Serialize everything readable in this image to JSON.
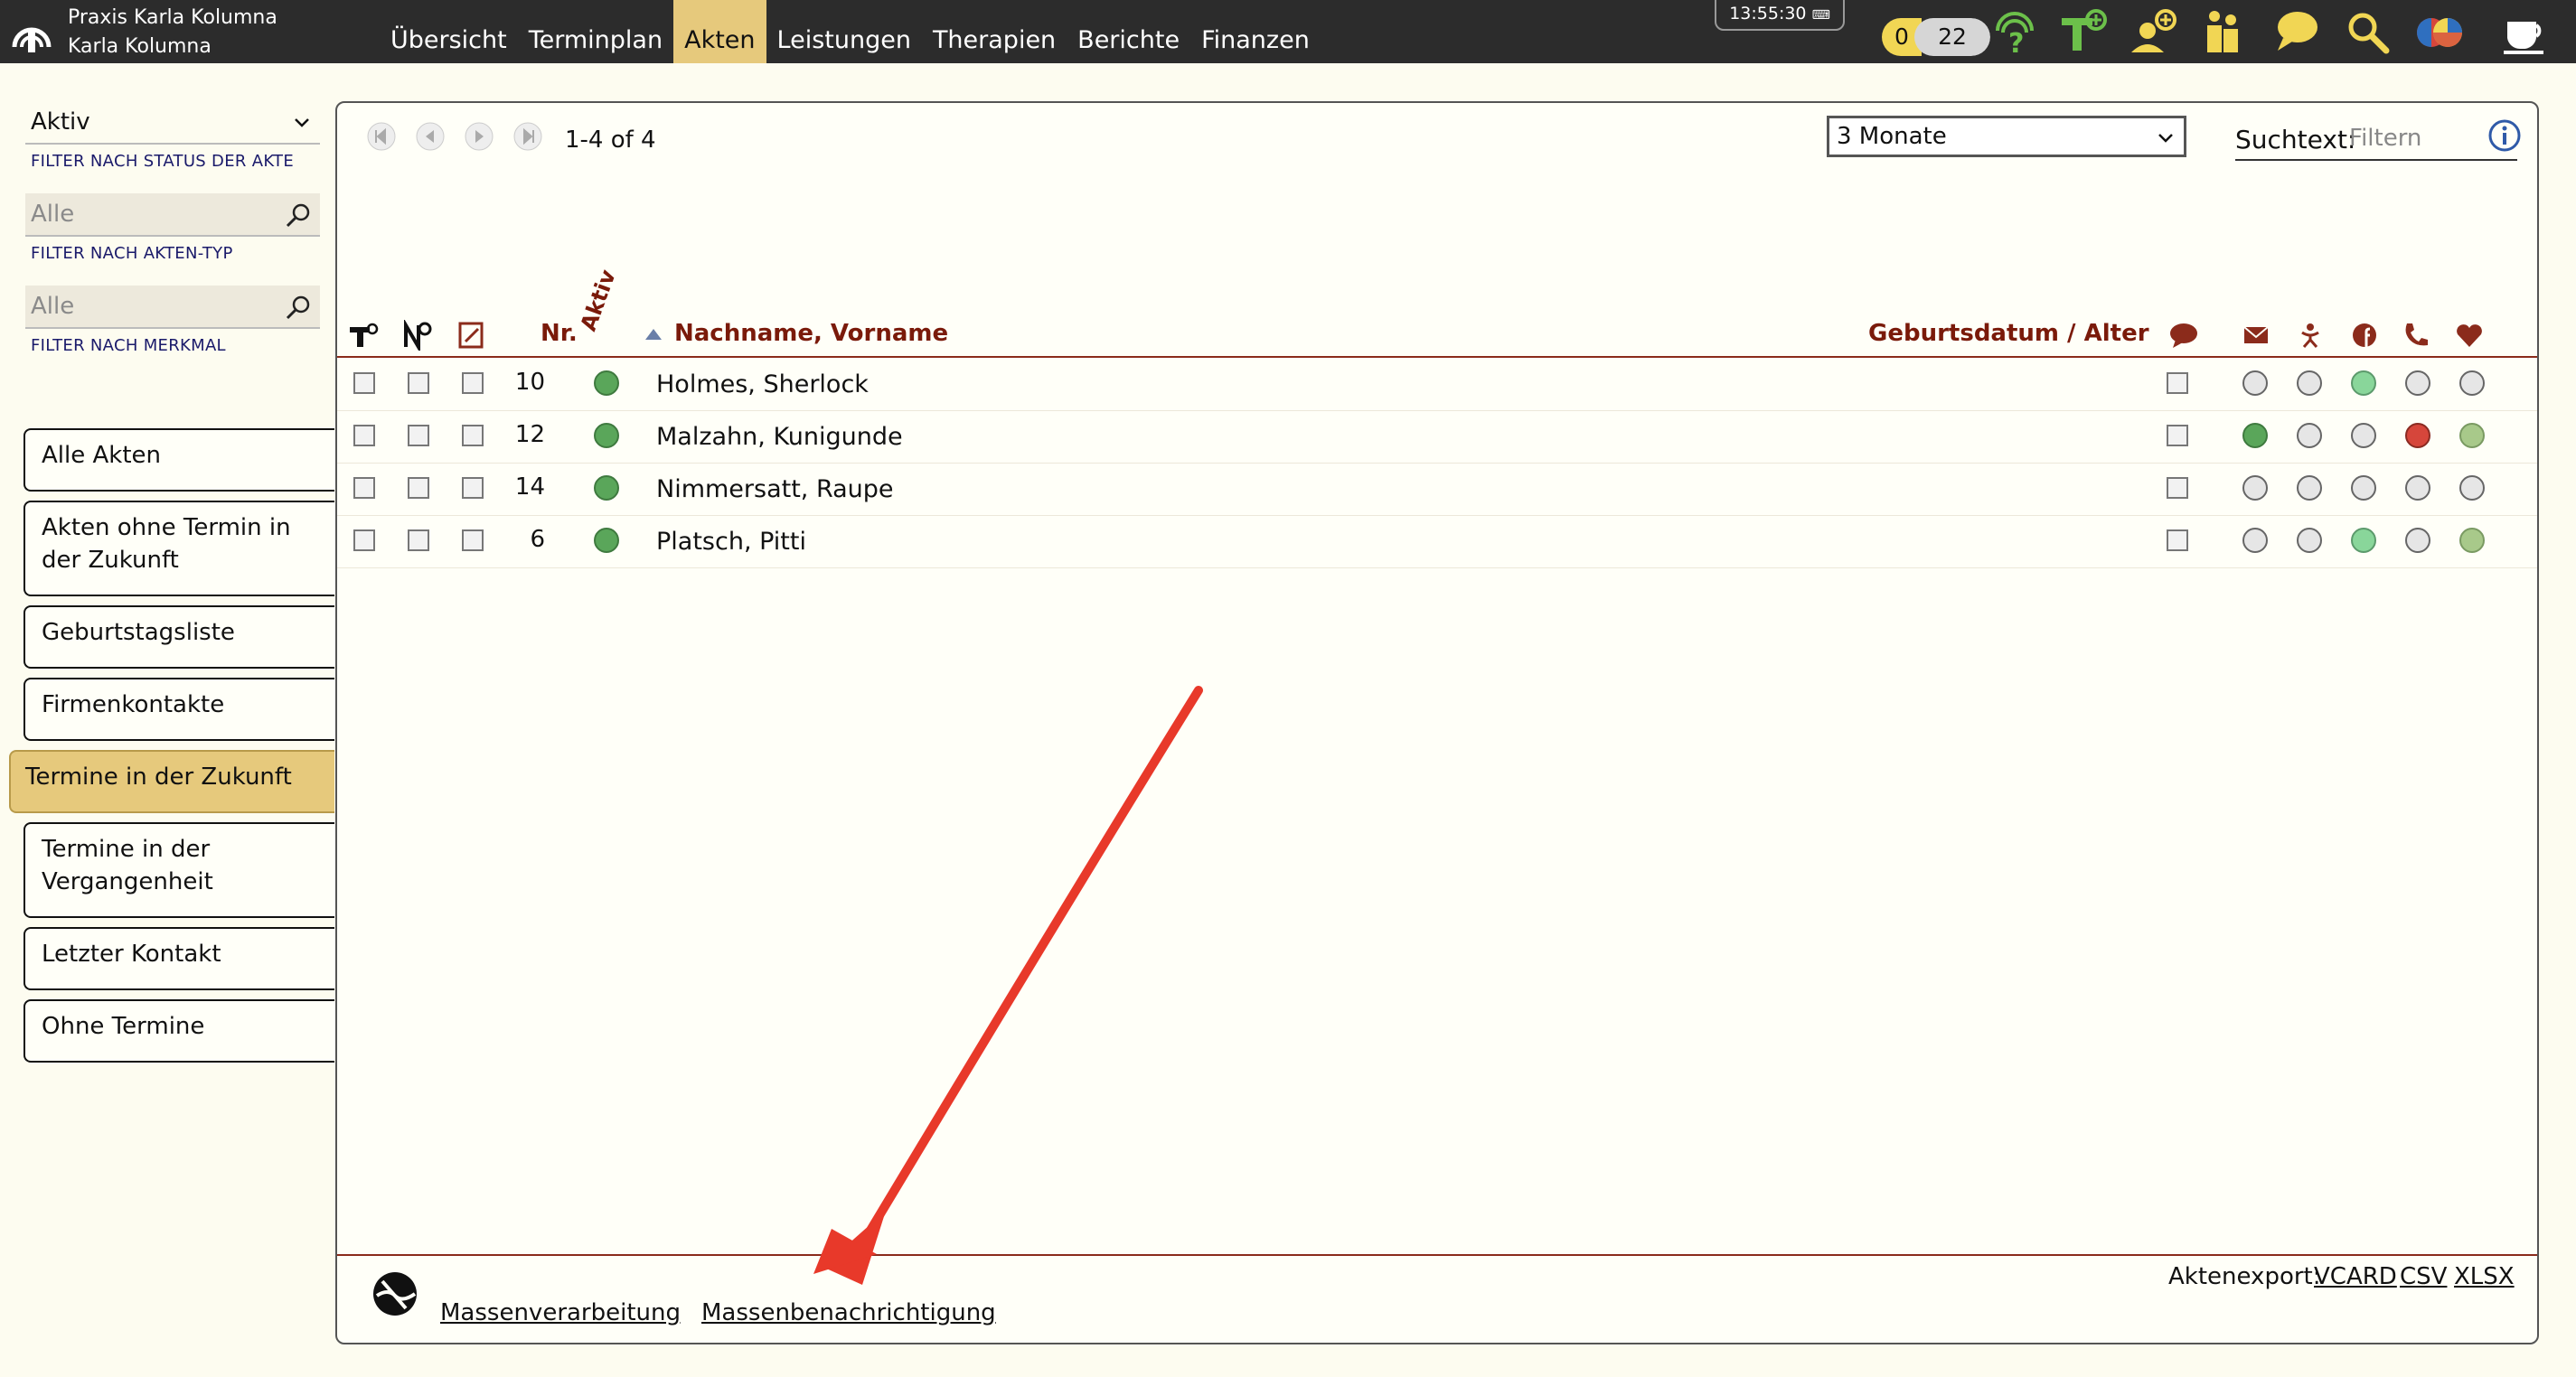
{
  "header": {
    "practice_line1": "Praxis Karla Kolumna",
    "practice_line2": "Karla Kolumna",
    "nav": [
      "Übersicht",
      "Terminplan",
      "Akten",
      "Leistungen",
      "Therapien",
      "Berichte",
      "Finanzen"
    ],
    "active_nav": "Akten",
    "clock": "13:55:30",
    "counter_a": "0",
    "counter_b": "22",
    "icons": [
      "help-icon",
      "treatment-add-icon",
      "patient-add-icon",
      "group-icon",
      "chat-icon",
      "search-icon",
      "flags-icon",
      "coffee-icon"
    ]
  },
  "sidebar": {
    "status_filter": {
      "value": "Aktiv",
      "caption": "FILTER NACH STATUS DER AKTE"
    },
    "type_filter": {
      "placeholder": "Alle",
      "caption": "FILTER NACH AKTEN-TYP"
    },
    "feature_filter": {
      "placeholder": "Alle",
      "caption": "FILTER NACH MERKMAL"
    },
    "buttons": [
      "Alle Akten",
      "Akten ohne Termin in der Zukunft",
      "Geburtstagsliste",
      "Firmenkontakte",
      "Termine in der Zukunft",
      "Termine in der Vergangenheit",
      "Letzter Kontakt",
      "Ohne Termine"
    ],
    "active_button": "Termine in der Zukunft"
  },
  "toolbar": {
    "page_count": "1-4 of 4",
    "range": "3 Monate",
    "search_label": "Suchtext:",
    "search_placeholder": "Filtern"
  },
  "table": {
    "col_nr": "Nr.",
    "col_active": "Aktiv",
    "col_name": "Nachname, Vorname",
    "col_birth": "Geburtsdatum / Alter",
    "rows": [
      {
        "nr": "10",
        "name": "Holmes, Sherlock",
        "status": [
          "grey",
          "grey",
          "lightgreen",
          "grey",
          "grey"
        ]
      },
      {
        "nr": "12",
        "name": "Malzahn, Kunigunde",
        "status": [
          "green",
          "grey",
          "grey",
          "red",
          "olive"
        ]
      },
      {
        "nr": "14",
        "name": "Nimmersatt, Raupe",
        "status": [
          "grey",
          "grey",
          "grey",
          "grey",
          "grey"
        ]
      },
      {
        "nr": "6",
        "name": "Platsch, Pitti",
        "status": [
          "grey",
          "grey",
          "lightgreen",
          "grey",
          "olive"
        ]
      }
    ],
    "status_icons": [
      "mail-icon",
      "person-icon",
      "facebook-icon",
      "phone-icon",
      "heart-icon"
    ]
  },
  "footer": {
    "mass_processing": "Massenverarbeitung",
    "mass_notification": "Massenbenachrichtigung",
    "export_label": "Aktenexport:",
    "exports": [
      "VCARD",
      "CSV",
      "XLSX"
    ]
  },
  "colors": {
    "accent": "#e6c97c",
    "header_text": "#7a1a0a",
    "topbar": "#2c2c2c",
    "annotation": "#e8392a"
  }
}
